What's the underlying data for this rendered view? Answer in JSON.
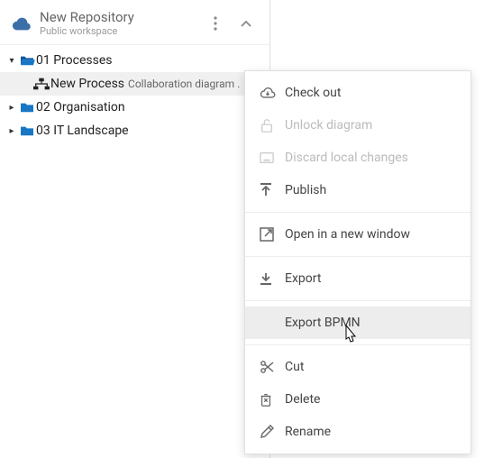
{
  "repo": {
    "title": "New Repository",
    "subtitle": "Public workspace"
  },
  "tree": {
    "items": [
      {
        "label": "01 Processes"
      },
      {
        "label": "New Process",
        "sublabel": "Collaboration diagram ."
      },
      {
        "label": "02 Organisation"
      },
      {
        "label": "03 IT Landscape"
      }
    ]
  },
  "menu": {
    "checkout": "Check out",
    "unlock": "Unlock diagram",
    "discard": "Discard local changes",
    "publish": "Publish",
    "open_new": "Open in a new window",
    "export": "Export",
    "export_bpmn": "Export BPMN",
    "cut": "Cut",
    "delete": "Delete",
    "rename": "Rename"
  }
}
